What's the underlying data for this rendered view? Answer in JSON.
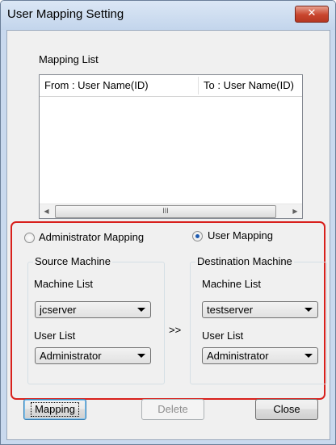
{
  "window": {
    "title": "User Mapping Setting",
    "close_icon": "close-icon",
    "close_glyph": "✕"
  },
  "mapping_list": {
    "label": "Mapping List",
    "columns": [
      "From : User Name(ID)",
      "To : User Name(ID)"
    ],
    "rows": [],
    "scroll_left": "◀",
    "scroll_right": "▶",
    "thumb_grip": "III"
  },
  "mode": {
    "options": [
      {
        "label": "Administrator Mapping",
        "selected": false
      },
      {
        "label": "User Mapping",
        "selected": true
      }
    ]
  },
  "source": {
    "title": "Source Machine",
    "machine_label": "Machine List",
    "machine_value": "jcserver",
    "user_label": "User List",
    "user_value": "Administrator"
  },
  "arrow_text": ">>",
  "destination": {
    "title": "Destination Machine",
    "machine_label": "Machine List",
    "machine_value": "testserver",
    "user_label": "User List",
    "user_value": "Administrator"
  },
  "buttons": {
    "mapping": "Mapping",
    "delete": "Delete",
    "close": "Close"
  },
  "colors": {
    "highlight": "#d8201c",
    "titlebar": "#c9d9ee",
    "close": "#c8452d"
  }
}
